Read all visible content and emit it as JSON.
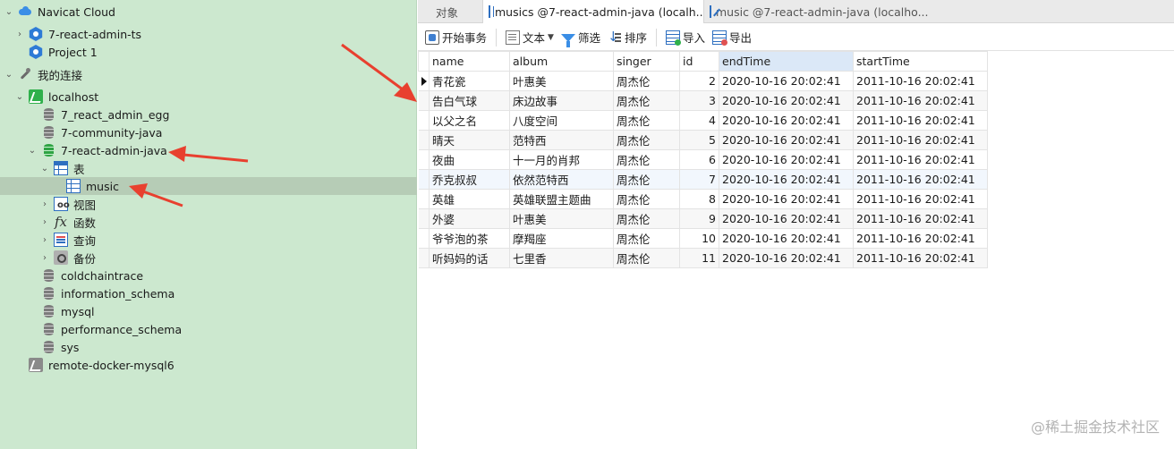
{
  "sidebar": {
    "items": [
      {
        "label": "Navicat Cloud",
        "icon": "cloud-icon",
        "expander": "expanded"
      },
      {
        "label": "7-react-admin-ts",
        "icon": "project-icon",
        "expander": "collapsed"
      },
      {
        "label": "Project 1",
        "icon": "project-icon",
        "expander": "none"
      },
      {
        "label": "我的连接",
        "icon": "connection-icon",
        "expander": "expanded"
      },
      {
        "label": "localhost",
        "icon": "mysql-connection-icon",
        "expander": "expanded"
      },
      {
        "label": "7_react_admin_egg",
        "icon": "database-icon",
        "expander": "none"
      },
      {
        "label": "7-community-java",
        "icon": "database-icon",
        "expander": "none"
      },
      {
        "label": "7-react-admin-java",
        "icon": "database-open-icon",
        "expander": "expanded"
      },
      {
        "label": "表",
        "icon": "tables-icon",
        "expander": "expanded"
      },
      {
        "label": "music",
        "icon": "table-icon",
        "expander": "none",
        "selected": true
      },
      {
        "label": "视图",
        "icon": "views-icon",
        "expander": "collapsed"
      },
      {
        "label": "函数",
        "icon": "function-icon",
        "expander": "collapsed"
      },
      {
        "label": "查询",
        "icon": "query-icon",
        "expander": "collapsed"
      },
      {
        "label": "备份",
        "icon": "backup-icon",
        "expander": "collapsed"
      },
      {
        "label": "coldchaintrace",
        "icon": "database-icon",
        "expander": "none"
      },
      {
        "label": "information_schema",
        "icon": "database-icon",
        "expander": "none"
      },
      {
        "label": "mysql",
        "icon": "database-icon",
        "expander": "none"
      },
      {
        "label": "performance_schema",
        "icon": "database-icon",
        "expander": "none"
      },
      {
        "label": "sys",
        "icon": "database-icon",
        "expander": "none"
      },
      {
        "label": "remote-docker-mysql6",
        "icon": "mysql-connection-icon",
        "expander": "none"
      }
    ]
  },
  "tabs": [
    {
      "label": "对象",
      "active": false
    },
    {
      "label": "musics @7-react-admin-java (localh...",
      "active": true
    },
    {
      "label": "music @7-react-admin-java (localho...",
      "active": false
    }
  ],
  "toolbar": {
    "begin_transaction": "开始事务",
    "text": "文本",
    "filter": "筛选",
    "sort": "排序",
    "import": "导入",
    "export": "导出"
  },
  "grid": {
    "columns": [
      "name",
      "album",
      "singer",
      "id",
      "endTime",
      "startTime"
    ],
    "rows": [
      [
        "青花瓷",
        "叶惠美",
        "周杰伦",
        "2",
        "2020-10-16 20:02:41",
        "2011-10-16 20:02:41"
      ],
      [
        "告白气球",
        "床边故事",
        "周杰伦",
        "3",
        "2020-10-16 20:02:41",
        "2011-10-16 20:02:41"
      ],
      [
        "以父之名",
        "八度空间",
        "周杰伦",
        "4",
        "2020-10-16 20:02:41",
        "2011-10-16 20:02:41"
      ],
      [
        "晴天",
        "范特西",
        "周杰伦",
        "5",
        "2020-10-16 20:02:41",
        "2011-10-16 20:02:41"
      ],
      [
        "夜曲",
        "十一月的肖邦",
        "周杰伦",
        "6",
        "2020-10-16 20:02:41",
        "2011-10-16 20:02:41"
      ],
      [
        "乔克叔叔",
        "依然范特西",
        "周杰伦",
        "7",
        "2020-10-16 20:02:41",
        "2011-10-16 20:02:41"
      ],
      [
        "英雄",
        "英雄联盟主题曲",
        "周杰伦",
        "8",
        "2020-10-16 20:02:41",
        "2011-10-16 20:02:41"
      ],
      [
        "外婆",
        "叶惠美",
        "周杰伦",
        "9",
        "2020-10-16 20:02:41",
        "2011-10-16 20:02:41"
      ],
      [
        "爷爷泡的茶",
        "摩羯座",
        "周杰伦",
        "10",
        "2020-10-16 20:02:41",
        "2011-10-16 20:02:41"
      ],
      [
        "听妈妈的话",
        "七里香",
        "周杰伦",
        "11",
        "2020-10-16 20:02:41",
        "2011-10-16 20:02:41"
      ]
    ]
  },
  "watermark": "@稀土掘金技术社区",
  "colors": {
    "sidebar_bg": "#cce8cf",
    "annotation_arrow": "#e8402f",
    "selected_row": "#b6ccb6"
  }
}
